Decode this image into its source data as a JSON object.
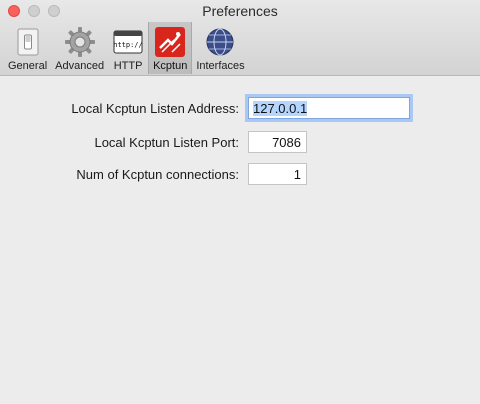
{
  "window": {
    "title": "Preferences"
  },
  "toolbar": {
    "items": [
      {
        "label": "General",
        "icon": "general-switch-icon",
        "selected": false
      },
      {
        "label": "Advanced",
        "icon": "gear-icon",
        "selected": false
      },
      {
        "label": "HTTP",
        "icon": "http-browser-icon",
        "selected": false
      },
      {
        "label": "Kcptun",
        "icon": "kcptun-icon",
        "selected": true
      },
      {
        "label": "Interfaces",
        "icon": "network-globe-icon",
        "selected": false
      }
    ]
  },
  "form": {
    "address": {
      "label": "Local Kcptun Listen Address:",
      "value": "127.0.0.1"
    },
    "port": {
      "label": "Local Kcptun Listen Port:",
      "value": "7086"
    },
    "connections": {
      "label": "Num of Kcptun connections:",
      "value": "1"
    }
  },
  "colors": {
    "close": "#fc605c",
    "kcptun_icon": "#d9261c",
    "focus_ring": "#a9c8f3",
    "selection": "#b4d5fe"
  }
}
